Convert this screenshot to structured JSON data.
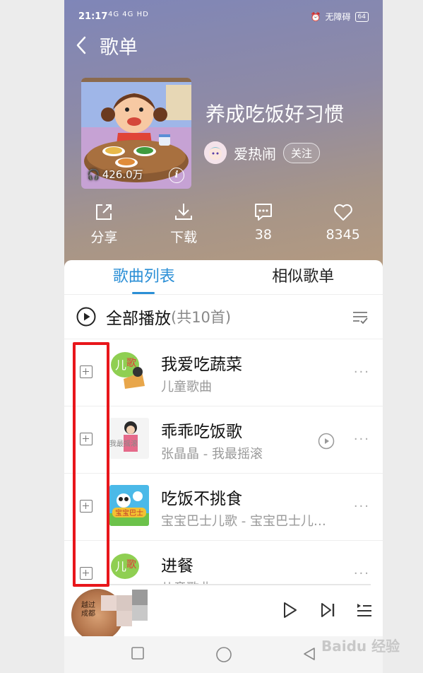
{
  "status_bar": {
    "time": "21:17",
    "signal": "4G 4G HD",
    "accessibility": "无障碍",
    "battery": "64"
  },
  "nav": {
    "title": "歌单"
  },
  "playlist": {
    "name": "养成吃饭好习惯",
    "plays": "426.0万",
    "creator": "爱热闹",
    "follow_label": "关注"
  },
  "actions": [
    {
      "icon": "share-icon",
      "label": "分享"
    },
    {
      "icon": "download-icon",
      "label": "下载"
    },
    {
      "icon": "comment-icon",
      "label": "38"
    },
    {
      "icon": "heart-icon",
      "label": "8345"
    }
  ],
  "tabs": [
    {
      "label": "歌曲列表",
      "active": true
    },
    {
      "label": "相似歌单",
      "active": false
    }
  ],
  "play_all": {
    "label": "全部播放",
    "count": "(共10首)"
  },
  "songs": [
    {
      "title": "我爱吃蔬菜",
      "subtitle": "儿童歌曲",
      "has_mv": false
    },
    {
      "title": "乖乖吃饭歌",
      "subtitle": "张晶晶 - 我最摇滚",
      "has_mv": true
    },
    {
      "title": "吃饭不挑食",
      "subtitle": "宝宝巴士儿歌 - 宝宝巴士儿…",
      "has_mv": false
    },
    {
      "title": "进餐",
      "subtitle": "儿童歌曲",
      "has_mv": false
    }
  ],
  "mini_player": {
    "disc_label": "越过 成都"
  },
  "watermark": "Baidu 经验",
  "colors": {
    "accent": "#2b8fd6",
    "highlight_box": "#e8161b"
  }
}
